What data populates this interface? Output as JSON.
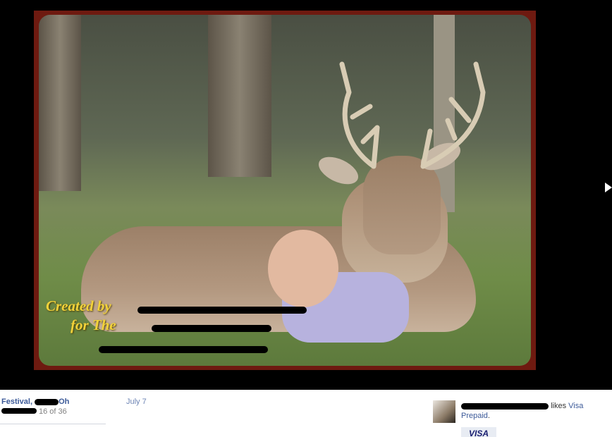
{
  "photo": {
    "caption_line1": "Created by",
    "caption_line2": "for The",
    "caption_line3": ""
  },
  "album": {
    "title": "Festival, ",
    "title_suffix": "Oh",
    "count": "16 of 36"
  },
  "post_date": "July 7",
  "activity": {
    "verb": "likes",
    "link": "Visa Prepaid",
    "suffix": "."
  },
  "icons": {
    "next": "next-arrow-icon"
  },
  "colors": {
    "link": "#3b5998",
    "caption": "#f2d23a",
    "frame": "#6e1a10"
  }
}
